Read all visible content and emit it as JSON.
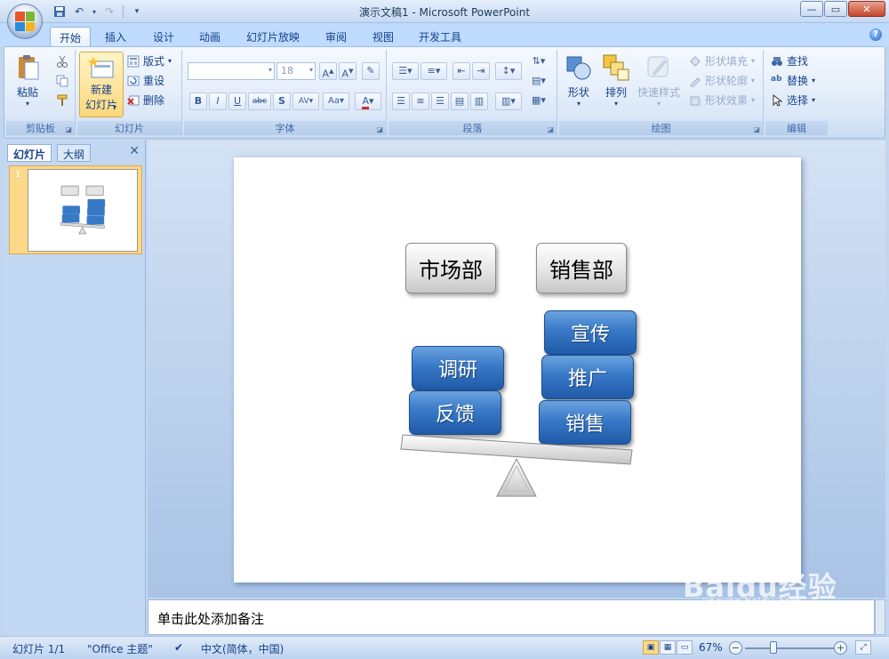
{
  "window": {
    "title": "演示文稿1 - Microsoft PowerPoint"
  },
  "ribbon_tabs": [
    "开始",
    "插入",
    "设计",
    "动画",
    "幻灯片放映",
    "审阅",
    "视图",
    "开发工具"
  ],
  "clipboard": {
    "paste": "粘贴",
    "label": "剪贴板"
  },
  "slides_group": {
    "new_slide": "新建",
    "new_slide2": "幻灯片",
    "layout": "版式",
    "reset": "重设",
    "delete": "删除",
    "label": "幻灯片"
  },
  "font_group": {
    "font_size": "18",
    "label": "字体"
  },
  "paragraph_group": {
    "label": "段落"
  },
  "drawing_group": {
    "shapes": "形状",
    "arrange": "排列",
    "quick_styles": "快速样式",
    "shape_fill": "形状填充",
    "shape_outline": "形状轮廓",
    "shape_effects": "形状效果",
    "label": "绘图"
  },
  "editing_group": {
    "find": "查找",
    "replace": "替换",
    "select": "选择",
    "label": "编辑"
  },
  "left_pane": {
    "tab_slides": "幻灯片",
    "tab_outline": "大纲",
    "slide_number": "1"
  },
  "slide": {
    "left_header": "市场部",
    "right_header": "销售部",
    "left_items": [
      "调研",
      "反馈"
    ],
    "right_items": [
      "宣传",
      "推广",
      "销售"
    ]
  },
  "notes": {
    "placeholder": "单击此处添加备注"
  },
  "statusbar": {
    "slide_info": "幻灯片 1/1",
    "theme": "\"Office 主题\"",
    "language": "中文(简体，中国)",
    "zoom": "67%"
  },
  "watermark": {
    "text": "Baidu经验",
    "sub": "jingyan.baidu.com"
  },
  "colors": {
    "ribbon_bg": "#dde9f8",
    "blue_box": "#3879c7",
    "selected_thumb": "#fcd889"
  }
}
